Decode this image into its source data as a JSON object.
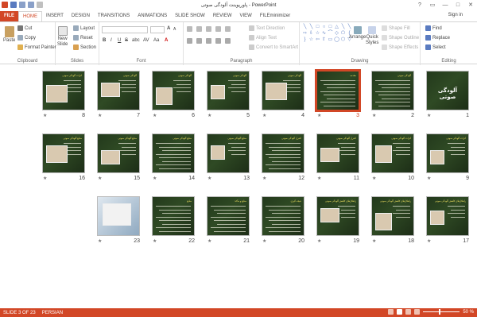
{
  "app": {
    "title": "پاورپوینت آلودگی صوتی - PowerPoint",
    "signin": "Sign in"
  },
  "window_controls": [
    "?",
    "▭",
    "—",
    "□",
    "✕"
  ],
  "tabs": [
    "FILE",
    "HOME",
    "INSERT",
    "DESIGN",
    "TRANSITIONS",
    "ANIMATIONS",
    "SLIDE SHOW",
    "REVIEW",
    "VIEW",
    "FILEminimizer"
  ],
  "ribbon": {
    "clipboard": {
      "paste": "Paste",
      "cut": "Cut",
      "copy": "Copy",
      "format_painter": "Format Painter",
      "label": "Clipboard"
    },
    "slides": {
      "new_slide": "New",
      "new_slide2": "Slide",
      "layout": "Layout",
      "reset": "Reset",
      "section": "Section",
      "label": "Slides"
    },
    "font": {
      "label": "Font",
      "bold": "B",
      "italic": "I",
      "underline": "U",
      "strike": "S",
      "shadow": "abc",
      "spacing": "AV",
      "case": "Aa",
      "grow": "A",
      "shrink": "A",
      "clear": "A"
    },
    "paragraph": {
      "text_direction": "Text Direction",
      "align_text": "Align Text",
      "convert": "Convert to SmartArt",
      "label": "Paragraph"
    },
    "drawing": {
      "arrange": "Arrange",
      "quick_styles": "Quick",
      "quick_styles2": "Styles",
      "shape_fill": "Shape Fill",
      "shape_outline": "Shape Outline",
      "shape_effects": "Shape Effects",
      "label": "Drawing"
    },
    "editing": {
      "find": "Find",
      "replace": "Replace",
      "select": "Select",
      "label": "Editing"
    }
  },
  "slides": [
    {
      "num": "1",
      "kind": "title",
      "title": "آلودگی صوتی"
    },
    {
      "num": "2",
      "kind": "text",
      "title": "آلودگی صوتی"
    },
    {
      "num": "3",
      "kind": "text",
      "title": "مقدمه",
      "selected": true
    },
    {
      "num": "4",
      "kind": "img",
      "title": "آلودگی صوتی"
    },
    {
      "num": "5",
      "kind": "img",
      "title": "آلودگی صوتی"
    },
    {
      "num": "6",
      "kind": "img",
      "title": "آلودگی صوتی"
    },
    {
      "num": "7",
      "kind": "img",
      "title": "آلودگی صوتی"
    },
    {
      "num": "8",
      "kind": "img",
      "title": "اثرات آلودگی صوتی"
    },
    {
      "num": "9",
      "kind": "img",
      "title": "اثرات آلودگی صوتی"
    },
    {
      "num": "10",
      "kind": "img",
      "title": "اثرات آلودگی صوتی"
    },
    {
      "num": "11",
      "kind": "img",
      "title": "کنترل آلودگی صوتی"
    },
    {
      "num": "12",
      "kind": "text",
      "title": "کنترل آلودگی صوتی"
    },
    {
      "num": "13",
      "kind": "img",
      "title": "منابع آلودگی صوتی"
    },
    {
      "num": "14",
      "kind": "text",
      "title": "منابع آلودگی صوتی"
    },
    {
      "num": "15",
      "kind": "img",
      "title": "منابع آلودگی صوتی"
    },
    {
      "num": "16",
      "kind": "img",
      "title": "منابع آلودگی صوتی"
    },
    {
      "num": "17",
      "kind": "img",
      "title": "راهکارهای کاهش آلودگی صوتی"
    },
    {
      "num": "18",
      "kind": "img",
      "title": "راهکارهای کاهش آلودگی صوتی"
    },
    {
      "num": "19",
      "kind": "img",
      "title": "راهکارهای کاهش آلودگی صوتی"
    },
    {
      "num": "20",
      "kind": "text",
      "title": "نتیجه گیری"
    },
    {
      "num": "21",
      "kind": "text",
      "title": "منابع و مآخذ"
    },
    {
      "num": "22",
      "kind": "text",
      "title": "منابع"
    },
    {
      "num": "23",
      "kind": "photo",
      "title": ""
    }
  ],
  "status": {
    "slide": "SLIDE 3 OF 23",
    "language": "PERSIAN",
    "zoom": "50 %"
  },
  "colors": {
    "accent": "#d24726",
    "slide_bg": "#2a4220"
  }
}
